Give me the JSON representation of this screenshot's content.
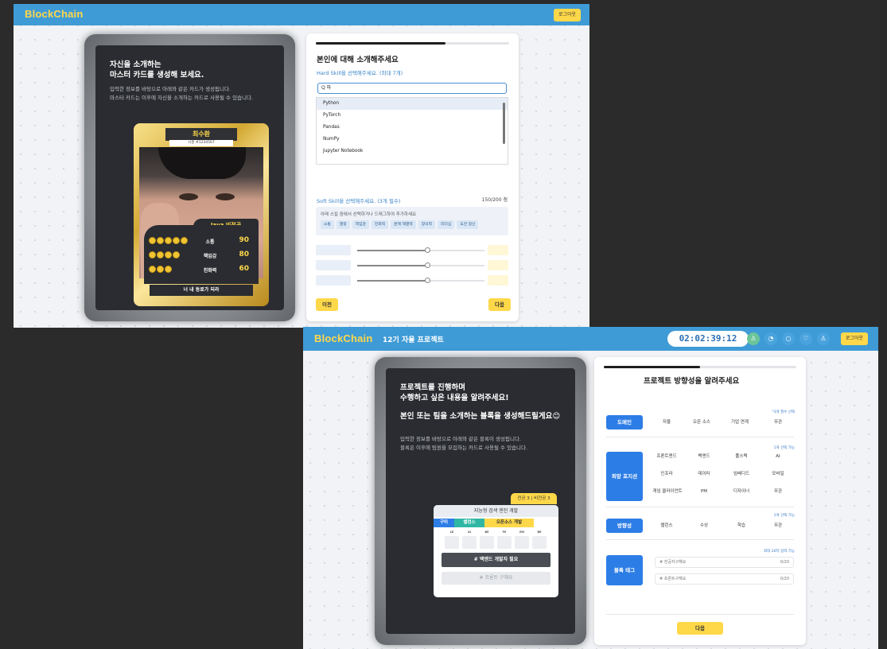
{
  "screen1": {
    "logo": "BlockChain",
    "logout": "로그아웃",
    "panel_title_1": "자신을 소개하는",
    "panel_title_2": "마스터 카드를 생성해 보세요.",
    "panel_desc_1": "입력한 정보를 바탕으로 아래와 같은 카드가 생성됩니다.",
    "panel_desc_2": "마스터 카드는 이후에 자신을 소개하는 카드로 사용될 수 있습니다.",
    "card": {
      "name": "최수환",
      "id": "시흥 #1234567",
      "major": "Java 비전공",
      "stats": [
        {
          "dots": 5,
          "label": "소통",
          "value": "90"
        },
        {
          "dots": 4,
          "label": "책임감",
          "value": "80"
        },
        {
          "dots": 3,
          "label": "친화력",
          "value": "60"
        }
      ],
      "slogan": "너 내 동료가 되라"
    },
    "form": {
      "title": "본인에 대해 소개해주세요",
      "hard_label": "Hard Skill을 선택해주세요. (최대 7개)",
      "search_value": "Q 파",
      "progress": 0.67,
      "options": [
        "Python",
        "PyTorch",
        "Pandas",
        "NumPy",
        "Jupyter Notebook"
      ],
      "soft_label": "Soft Skill을 선택해주세요. (3개 필수)",
      "points": "150/200 점",
      "soft_hint": "아래 스킬 중에서 선택하거나 드래그하여 추가하세요",
      "chips": [
        "소통",
        "열정",
        "책임감",
        "친화력",
        "문제 해결력",
        "창의력",
        "리더십",
        "도전 정신"
      ],
      "slider_levels": [
        0.55,
        0.55,
        0.55
      ],
      "prev": "이전",
      "next": "다음"
    }
  },
  "screen2": {
    "logo": "BlockChain",
    "subtitle": "12기 자율 프로젝트",
    "timer": "02:02:39:12",
    "icons": [
      "user-icon",
      "bell-icon",
      "chat-icon",
      "heart-icon",
      "profile-icon"
    ],
    "logout": "로그아웃",
    "panel_title_1": "프로젝트를 진행하며",
    "panel_title_2": "수행하고 싶은 내용을 알려주세요!",
    "panel_title_3": "본인 또는 팀을 소개하는 블록을 생성해드릴게요😊",
    "panel_desc_1": "입력한 정보를 바탕으로 아래와 같은 블록이 생성됩니다.",
    "panel_desc_2": "블록은 이후에 팀원을 모집하는 카드로 사용될 수 있습니다.",
    "block": {
      "major_tag": "전공 3 | 비전공 3",
      "title": "지능형 검색 엔진 개발",
      "tags": [
        "구미",
        "밸런스",
        "오픈소스 개발"
      ],
      "roles": [
        "LE",
        "AI",
        "BE",
        "FE",
        "EM",
        "BE"
      ],
      "need": "# 백엔드 개발자 필요",
      "front": "# 프론트 구해요"
    },
    "form": {
      "title": "프로젝트 방향성을 알려주세요",
      "progress": 0.5,
      "domain_note": "*3개 필수 선택",
      "domain_label": "도메인",
      "domain_opts": [
        "자율",
        "오픈 소스",
        "기업 연계",
        "무관"
      ],
      "position_note": "1개 선택 가능",
      "position_label": "희망 포지션",
      "position_opts": [
        "프론트엔드",
        "백엔드",
        "풀스택",
        "AI",
        "인프라",
        "데이터",
        "임베디드",
        "모바일",
        "게임 클라이언트",
        "PM",
        "디자이너",
        "무관"
      ],
      "direction_note": "1개 선택 가능",
      "direction_label": "방향성",
      "direction_opts": [
        "밸런스",
        "수상",
        "학습",
        "무관"
      ],
      "tag_note": "최대 20자 입력 가능",
      "tag_label": "블록 태그",
      "tag_placeholders": [
        "# 전공자구해요",
        "# 프론트구해요"
      ],
      "tag_counts": [
        "0/20",
        "0/20"
      ],
      "next": "다음"
    }
  }
}
